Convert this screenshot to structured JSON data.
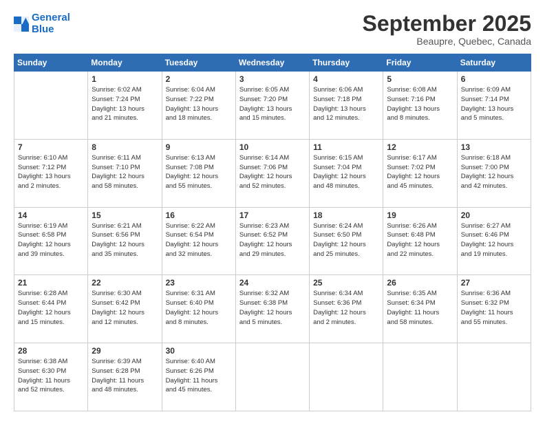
{
  "header": {
    "logo_line1": "General",
    "logo_line2": "Blue",
    "month": "September 2025",
    "location": "Beaupre, Quebec, Canada"
  },
  "weekdays": [
    "Sunday",
    "Monday",
    "Tuesday",
    "Wednesday",
    "Thursday",
    "Friday",
    "Saturday"
  ],
  "weeks": [
    [
      {
        "day": "",
        "info": ""
      },
      {
        "day": "1",
        "info": "Sunrise: 6:02 AM\nSunset: 7:24 PM\nDaylight: 13 hours\nand 21 minutes."
      },
      {
        "day": "2",
        "info": "Sunrise: 6:04 AM\nSunset: 7:22 PM\nDaylight: 13 hours\nand 18 minutes."
      },
      {
        "day": "3",
        "info": "Sunrise: 6:05 AM\nSunset: 7:20 PM\nDaylight: 13 hours\nand 15 minutes."
      },
      {
        "day": "4",
        "info": "Sunrise: 6:06 AM\nSunset: 7:18 PM\nDaylight: 13 hours\nand 12 minutes."
      },
      {
        "day": "5",
        "info": "Sunrise: 6:08 AM\nSunset: 7:16 PM\nDaylight: 13 hours\nand 8 minutes."
      },
      {
        "day": "6",
        "info": "Sunrise: 6:09 AM\nSunset: 7:14 PM\nDaylight: 13 hours\nand 5 minutes."
      }
    ],
    [
      {
        "day": "7",
        "info": "Sunrise: 6:10 AM\nSunset: 7:12 PM\nDaylight: 13 hours\nand 2 minutes."
      },
      {
        "day": "8",
        "info": "Sunrise: 6:11 AM\nSunset: 7:10 PM\nDaylight: 12 hours\nand 58 minutes."
      },
      {
        "day": "9",
        "info": "Sunrise: 6:13 AM\nSunset: 7:08 PM\nDaylight: 12 hours\nand 55 minutes."
      },
      {
        "day": "10",
        "info": "Sunrise: 6:14 AM\nSunset: 7:06 PM\nDaylight: 12 hours\nand 52 minutes."
      },
      {
        "day": "11",
        "info": "Sunrise: 6:15 AM\nSunset: 7:04 PM\nDaylight: 12 hours\nand 48 minutes."
      },
      {
        "day": "12",
        "info": "Sunrise: 6:17 AM\nSunset: 7:02 PM\nDaylight: 12 hours\nand 45 minutes."
      },
      {
        "day": "13",
        "info": "Sunrise: 6:18 AM\nSunset: 7:00 PM\nDaylight: 12 hours\nand 42 minutes."
      }
    ],
    [
      {
        "day": "14",
        "info": "Sunrise: 6:19 AM\nSunset: 6:58 PM\nDaylight: 12 hours\nand 39 minutes."
      },
      {
        "day": "15",
        "info": "Sunrise: 6:21 AM\nSunset: 6:56 PM\nDaylight: 12 hours\nand 35 minutes."
      },
      {
        "day": "16",
        "info": "Sunrise: 6:22 AM\nSunset: 6:54 PM\nDaylight: 12 hours\nand 32 minutes."
      },
      {
        "day": "17",
        "info": "Sunrise: 6:23 AM\nSunset: 6:52 PM\nDaylight: 12 hours\nand 29 minutes."
      },
      {
        "day": "18",
        "info": "Sunrise: 6:24 AM\nSunset: 6:50 PM\nDaylight: 12 hours\nand 25 minutes."
      },
      {
        "day": "19",
        "info": "Sunrise: 6:26 AM\nSunset: 6:48 PM\nDaylight: 12 hours\nand 22 minutes."
      },
      {
        "day": "20",
        "info": "Sunrise: 6:27 AM\nSunset: 6:46 PM\nDaylight: 12 hours\nand 19 minutes."
      }
    ],
    [
      {
        "day": "21",
        "info": "Sunrise: 6:28 AM\nSunset: 6:44 PM\nDaylight: 12 hours\nand 15 minutes."
      },
      {
        "day": "22",
        "info": "Sunrise: 6:30 AM\nSunset: 6:42 PM\nDaylight: 12 hours\nand 12 minutes."
      },
      {
        "day": "23",
        "info": "Sunrise: 6:31 AM\nSunset: 6:40 PM\nDaylight: 12 hours\nand 8 minutes."
      },
      {
        "day": "24",
        "info": "Sunrise: 6:32 AM\nSunset: 6:38 PM\nDaylight: 12 hours\nand 5 minutes."
      },
      {
        "day": "25",
        "info": "Sunrise: 6:34 AM\nSunset: 6:36 PM\nDaylight: 12 hours\nand 2 minutes."
      },
      {
        "day": "26",
        "info": "Sunrise: 6:35 AM\nSunset: 6:34 PM\nDaylight: 11 hours\nand 58 minutes."
      },
      {
        "day": "27",
        "info": "Sunrise: 6:36 AM\nSunset: 6:32 PM\nDaylight: 11 hours\nand 55 minutes."
      }
    ],
    [
      {
        "day": "28",
        "info": "Sunrise: 6:38 AM\nSunset: 6:30 PM\nDaylight: 11 hours\nand 52 minutes."
      },
      {
        "day": "29",
        "info": "Sunrise: 6:39 AM\nSunset: 6:28 PM\nDaylight: 11 hours\nand 48 minutes."
      },
      {
        "day": "30",
        "info": "Sunrise: 6:40 AM\nSunset: 6:26 PM\nDaylight: 11 hours\nand 45 minutes."
      },
      {
        "day": "",
        "info": ""
      },
      {
        "day": "",
        "info": ""
      },
      {
        "day": "",
        "info": ""
      },
      {
        "day": "",
        "info": ""
      }
    ]
  ]
}
